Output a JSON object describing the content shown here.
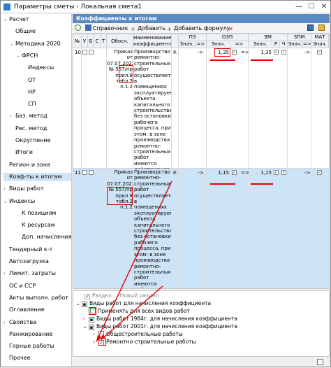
{
  "window": {
    "title": "Параметры сметы - Локальная смета1",
    "controls": [
      "—",
      "☐",
      "✕"
    ]
  },
  "nav": {
    "items": [
      {
        "label": "Расчет",
        "level": 0,
        "arrow": "⌄"
      },
      {
        "label": "Общие",
        "level": 1,
        "arrow": ""
      },
      {
        "label": "Методика 2020",
        "level": 1,
        "arrow": "⌄"
      },
      {
        "label": "ФРСН",
        "level": 2,
        "arrow": "⌄"
      },
      {
        "label": "Индексы",
        "level": 3,
        "arrow": ""
      },
      {
        "label": "ОТ",
        "level": 3,
        "arrow": ""
      },
      {
        "label": "НР",
        "level": 3,
        "arrow": ""
      },
      {
        "label": "СП",
        "level": 3,
        "arrow": ""
      },
      {
        "label": "Баз. метод",
        "level": 1,
        "arrow": "›"
      },
      {
        "label": "Рес. метод",
        "level": 1,
        "arrow": ""
      },
      {
        "label": "Округление",
        "level": 1,
        "arrow": ""
      },
      {
        "label": "Итоги",
        "level": 1,
        "arrow": ""
      },
      {
        "label": "Регион и зона",
        "level": 0,
        "arrow": ""
      },
      {
        "label": "Коэф-ты к итогам",
        "level": 0,
        "arrow": "",
        "selected": true
      },
      {
        "label": "Виды работ",
        "level": 0,
        "arrow": "›"
      },
      {
        "label": "Индексы",
        "level": 0,
        "arrow": "⌄"
      },
      {
        "label": "К позициям",
        "level": 2,
        "arrow": ""
      },
      {
        "label": "К ресурсам",
        "level": 2,
        "arrow": ""
      },
      {
        "label": "Доп. начисления",
        "level": 2,
        "arrow": ""
      },
      {
        "label": "Тендерный к-т",
        "level": 0,
        "arrow": ""
      },
      {
        "label": "Автозагрузка",
        "level": 0,
        "arrow": ""
      },
      {
        "label": "Лимит. затраты",
        "level": 0,
        "arrow": "›"
      },
      {
        "label": "ОС и ССР",
        "level": 0,
        "arrow": ""
      },
      {
        "label": "Акты выполн. работ",
        "level": 0,
        "arrow": ""
      },
      {
        "label": "Оглавление",
        "level": 0,
        "arrow": ""
      },
      {
        "label": "Свойства",
        "level": 0,
        "arrow": "›"
      },
      {
        "label": "Ранжирование",
        "level": 0,
        "arrow": ""
      },
      {
        "label": "Горные работы",
        "level": 0,
        "arrow": ""
      },
      {
        "label": "Прочее",
        "level": 0,
        "arrow": ""
      }
    ]
  },
  "panel": {
    "title": "Коэффициенты к итогам",
    "toolbar": {
      "reference": "Справочник",
      "add": "Добавить",
      "add_formula": "Добавить формулу"
    }
  },
  "grid": {
    "headers": {
      "num": "№",
      "u": "У",
      "b": "Б",
      "c": "С",
      "t": "Т",
      "basis": "Обосн.",
      "name": "Наименование коэффициента",
      "pz": "ПЗ",
      "ozp": "ОЗП",
      "em": "ЭМ",
      "zpm": "ЗПМ",
      "mat": "МАТ",
      "val": "Знач.",
      "op": "=>",
      "r": "Р",
      "ch": "Ч"
    },
    "rows": [
      {
        "num": "10",
        "basis": "Приказ от 07.07.2022 № 557/пр прил.8 табл.3 п.1.2",
        "name": "Производство ремонтно-строительных работ осуществляется в помещениях эксплуатируемого объекта капитального строительства без остановки рабочего процесса, при этом: в зоне производства ремонтно-строительных работ имеются действующее технологическое или лабораторное оборудование, мебель и иные загромождающие помещения предметы",
        "k": "К",
        "ozp_op": "=>",
        "ozp_value": "1,35",
        "em_value": "1,35",
        "pz_op": "->",
        "zpm_op": "->",
        "selected": false
      },
      {
        "num": "11",
        "basis": "Приказ от 07.07.2022 № 557/пр прил.8 табл.3 п.1.2",
        "name": "Производство ремонтно-строительных работ осуществляется в помещениях эксплуатируемого объекта капитального строительства без остановки рабочего процесса, при этом: в зоне производства ремонтно-строительных работ имеются действующее технологическое или лабораторное оборудование, мебель и иные загромождающие помещения предметы",
        "k": "К",
        "ozp_op": "=>",
        "ozp_value": "1,15",
        "em_value": "1,15",
        "pz_op": "->",
        "zpm_op": "->",
        "selected": true
      }
    ]
  },
  "bottom": {
    "partial_label": "Раздел ... Новый раздел",
    "worktypes_title": "Виды работ для начисления коэффициента",
    "apply_all": "Применять для всех видов работ",
    "types_1984": "Виды работ 1984г. для начисления коэффициента",
    "types_2001": "Виды работ 2001г. для начисления коэффициента",
    "general": "Общестроительные работы",
    "repair": "Ремонтно-строительные работы"
  },
  "colors": {
    "header_blue": "#5b8ac2",
    "selected_row": "#cde3f6",
    "annotation_red": "#e00000"
  }
}
